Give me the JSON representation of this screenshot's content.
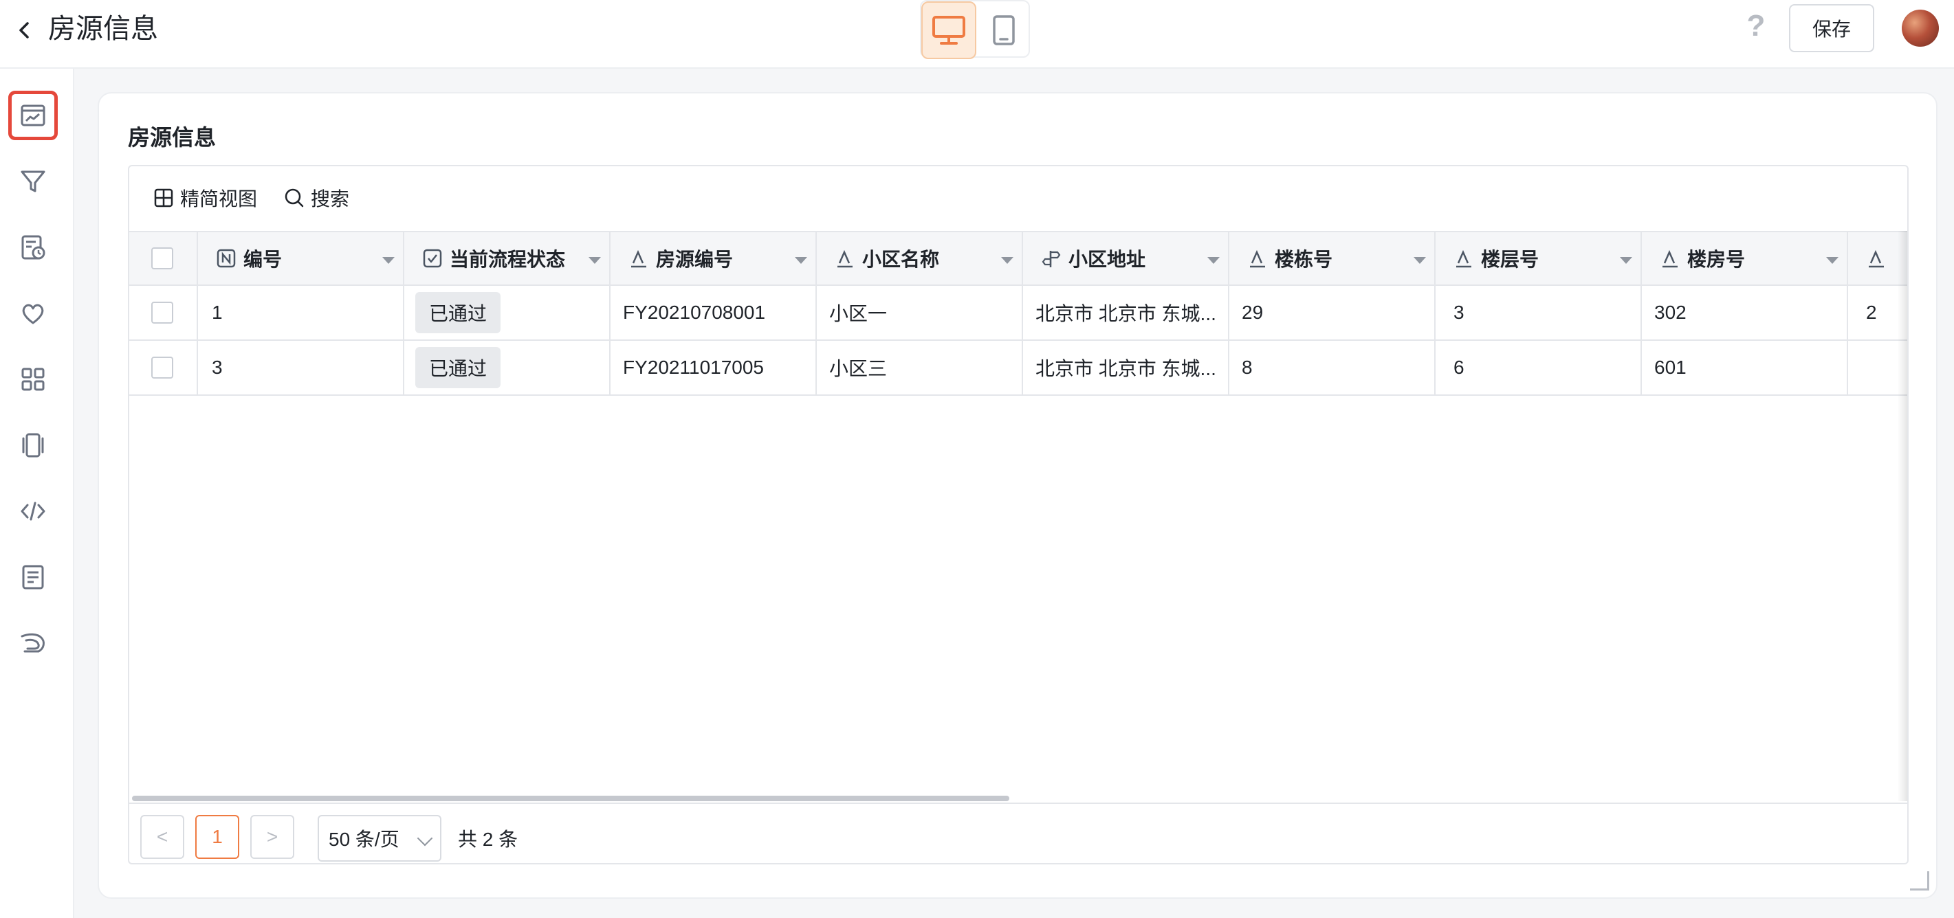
{
  "header": {
    "title": "房源信息",
    "save_label": "保存",
    "help_glyph": "?",
    "devices": [
      {
        "name": "desktop",
        "icon": "desktop-icon",
        "active": true
      },
      {
        "name": "tablet",
        "icon": "tablet-icon",
        "active": false
      }
    ]
  },
  "sidebar": {
    "items": [
      {
        "icon": "chart-panel-icon",
        "active": true
      },
      {
        "icon": "filter-icon",
        "active": false
      },
      {
        "icon": "report-clock-icon",
        "active": false
      },
      {
        "icon": "heart-icon",
        "active": false
      },
      {
        "icon": "grid-apps-icon",
        "active": false
      },
      {
        "icon": "devices-icon",
        "active": false
      },
      {
        "icon": "code-icon",
        "active": false
      },
      {
        "icon": "document-icon",
        "active": false
      },
      {
        "icon": "plugin-icon",
        "active": false
      }
    ]
  },
  "card": {
    "title": "房源信息",
    "toolbar": {
      "compact_view": "精简视图",
      "search": "搜索"
    }
  },
  "table": {
    "columns": [
      {
        "label": "编号",
        "icon": "number-field-icon"
      },
      {
        "label": "当前流程状态",
        "icon": "checkbox-field-icon"
      },
      {
        "label": "房源编号",
        "icon": "text-field-icon"
      },
      {
        "label": "小区名称",
        "icon": "text-field-icon"
      },
      {
        "label": "小区地址",
        "icon": "address-field-icon"
      },
      {
        "label": "楼栋号",
        "icon": "text-field-icon"
      },
      {
        "label": "楼层号",
        "icon": "text-field-icon"
      },
      {
        "label": "楼房号",
        "icon": "text-field-icon"
      },
      {
        "label": "",
        "icon": "text-field-icon"
      }
    ],
    "rows": [
      {
        "id": "1",
        "status": "已通过",
        "house_no": "FY20210708001",
        "community": "小区一",
        "address": "北京市 北京市 东城...",
        "building": "29",
        "floor": "3",
        "room": "302",
        "extra": "2"
      },
      {
        "id": "3",
        "status": "已通过",
        "house_no": "FY20211017005",
        "community": "小区三",
        "address": "北京市 北京市 东城...",
        "building": "8",
        "floor": "6",
        "room": "601",
        "extra": ""
      }
    ]
  },
  "pagination": {
    "prev": "<",
    "next": ">",
    "current_page": "1",
    "page_size": "50 条/页",
    "total": "共 2 条"
  },
  "colors": {
    "accent": "#ef7b42",
    "active_rail_border": "#e5483b",
    "badge_bg": "#e8eaed",
    "page_bg": "#f5f6f8"
  }
}
